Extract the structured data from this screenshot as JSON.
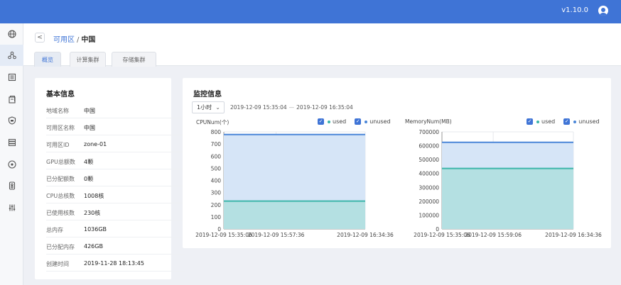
{
  "topbar": {
    "version": "v1.10.0",
    "avatar_icon": "user-circle-icon"
  },
  "sidebar": {
    "items": [
      {
        "icon": "globe-icon"
      },
      {
        "icon": "cluster-icon"
      },
      {
        "icon": "list-icon"
      },
      {
        "icon": "storage-icon"
      },
      {
        "icon": "shield-icon"
      },
      {
        "icon": "server-icon"
      },
      {
        "icon": "disc-icon"
      },
      {
        "icon": "device-icon"
      },
      {
        "icon": "sliders-icon"
      }
    ]
  },
  "breadcrumb": {
    "back": "<",
    "parent": "可用区",
    "separator": "/",
    "current": "中国"
  },
  "tabs": [
    {
      "label": "概览",
      "active": true
    },
    {
      "label": "计算集群",
      "active": false
    },
    {
      "label": "存储集群",
      "active": false
    }
  ],
  "basic_info": {
    "title": "基本信息",
    "rows": [
      {
        "key": "地域名称",
        "value": "中国"
      },
      {
        "key": "可用区名称",
        "value": "中国"
      },
      {
        "key": "可用区ID",
        "value": "zone-01"
      },
      {
        "key": "GPU总额数",
        "value": "4颗"
      },
      {
        "key": "已分配额数",
        "value": "0颗"
      },
      {
        "key": "CPU总核数",
        "value": "1008核"
      },
      {
        "key": "已使用核数",
        "value": "230核"
      },
      {
        "key": "总内存",
        "value": "1036GB"
      },
      {
        "key": "已分配内存",
        "value": "426GB"
      },
      {
        "key": "创建时间",
        "value": "2019-11-28 18:13:45"
      }
    ]
  },
  "monitor": {
    "title": "监控信息",
    "range_select": "1小时",
    "range_start": "2019-12-09 15:35:04",
    "range_sep": "—",
    "range_end": "2019-12-09 16:35:04",
    "legend_used": "used",
    "legend_unused": "unused"
  },
  "colors": {
    "accent": "#3f74d6",
    "used_line": "#3bb5a8",
    "used_fill": "#b4e0e2",
    "unused_line": "#4a86d8",
    "unused_fill": "#d6e5f7"
  },
  "chart_data": [
    {
      "type": "area",
      "ytitle": "CPUNum(个)",
      "ylim": [
        0,
        800
      ],
      "yticks": [
        0,
        100,
        200,
        300,
        400,
        500,
        600,
        700,
        800
      ],
      "xticks": [
        "2019-12-09 15:35:06",
        "2019-12-09 15:57:36",
        "2019-12-09 16:34:36"
      ],
      "series": [
        {
          "name": "used",
          "values": [
            230,
            230,
            230
          ]
        },
        {
          "name": "unused",
          "values": [
            778,
            778,
            778
          ]
        }
      ],
      "legend": "top-right",
      "grid": true
    },
    {
      "type": "area",
      "ytitle": "MemoryNum(MB)",
      "ylim": [
        0,
        700000
      ],
      "yticks": [
        0,
        100000,
        200000,
        300000,
        400000,
        500000,
        600000,
        700000
      ],
      "xticks": [
        "2019-12-09 15:35:06",
        "2019-12-09 15:59:06",
        "2019-12-09 16:34:36"
      ],
      "series": [
        {
          "name": "used",
          "values": [
            436224,
            436224,
            436224
          ]
        },
        {
          "name": "unused",
          "values": [
            624640,
            624640,
            624640
          ]
        }
      ],
      "legend": "top-right",
      "grid": true
    }
  ]
}
